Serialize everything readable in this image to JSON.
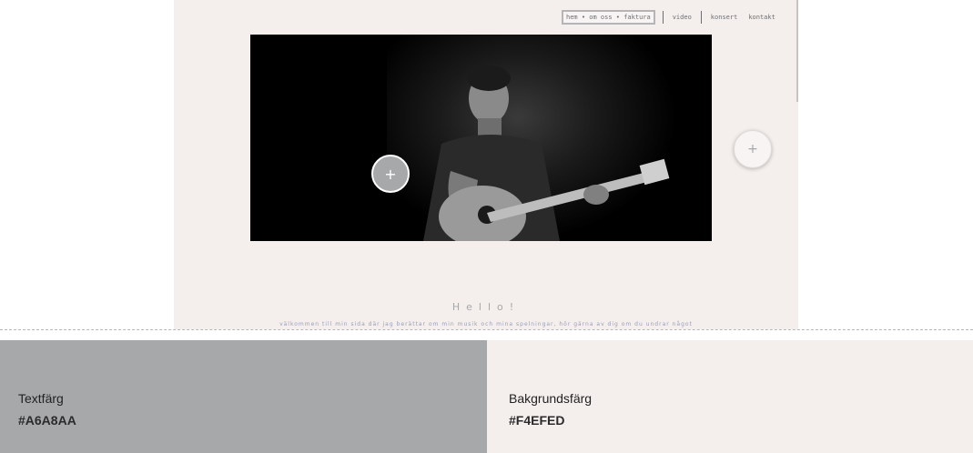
{
  "colors": {
    "text_color": "#A6A8AA",
    "background_color": "#F4EFED"
  },
  "preview": {
    "nav": {
      "items": [
        {
          "label": "hem • om oss • faktura"
        },
        {
          "label": "video"
        },
        {
          "label": "konsert"
        },
        {
          "label": "kontakt"
        }
      ]
    },
    "hero": {
      "image_alt": "",
      "add_button_label": "+"
    },
    "side_add_button_label": "+",
    "greeting": "Hello!",
    "intro_text": "välkommen till min sida där jag berättar om min musik och mina spelningar, hör gärna av dig om du undrar något"
  },
  "swatches": [
    {
      "label": "Textfärg",
      "hex": "#A6A8AA"
    },
    {
      "label": "Bakgrundsfärg",
      "hex": "#F4EFED"
    }
  ]
}
